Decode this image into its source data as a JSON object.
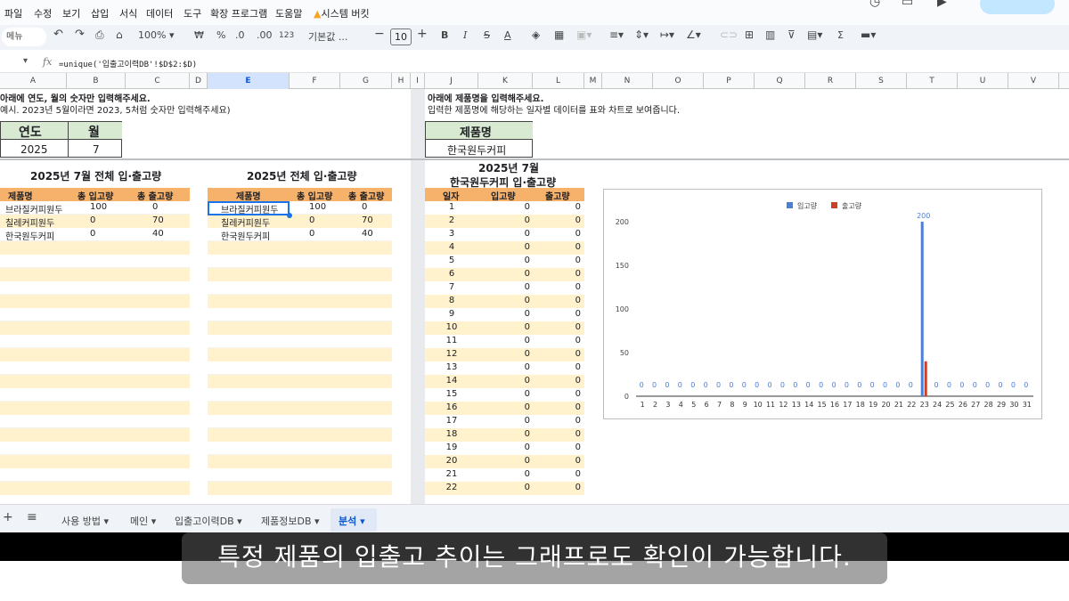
{
  "menu": [
    "파일",
    "수정",
    "보기",
    "삽입",
    "서식",
    "데이터",
    "도구",
    "확장 프로그램",
    "도움말",
    "시스템 버킷"
  ],
  "toolbar": {
    "menu_search": "메뉴",
    "zoom": "100%",
    "currency": "₩",
    "percent": "%",
    "dec_decrease": ".0",
    "dec_increase": ".00",
    "number_format": "123",
    "font": "기본값 ...",
    "font_size": "10",
    "bold": "B",
    "italic": "I",
    "strike": "S",
    "text_color": "A",
    "sigma": "Σ"
  },
  "formula_bar": {
    "cell_ref": "",
    "fx": "fx",
    "formula": "=unique('입출고이력DB'!$D$2:$D)"
  },
  "columns": [
    "A",
    "B",
    "C",
    "D",
    "E",
    "F",
    "G",
    "H",
    "I",
    "J",
    "K",
    "L",
    "M",
    "N",
    "O",
    "P",
    "Q",
    "R",
    "S",
    "T",
    "U",
    "V"
  ],
  "left": {
    "instr1": "아래에 연도, 월의 숫자만 입력해주세요.",
    "instr2": "예시. 2023년 5월이라면 2023, 5처럼 숫자만 입력해주세요)",
    "year_label": "연도",
    "month_label": "월",
    "year": "2025",
    "month": "7"
  },
  "table1": {
    "title": "2025년 7월 전체 입·출고량",
    "headers": [
      "제품명",
      "총 입고량",
      "총 출고량"
    ],
    "rows": [
      [
        "브라질커피원두",
        "100",
        "0"
      ],
      [
        "칠레커피원두",
        "0",
        "70"
      ],
      [
        "한국원두커피",
        "0",
        "40"
      ]
    ]
  },
  "table2": {
    "title": "2025년 전체 입·출고량",
    "headers": [
      "제품명",
      "총 입고량",
      "총 출고량"
    ],
    "rows": [
      [
        "브라질커피원두",
        "100",
        "0"
      ],
      [
        "칠레커피원두",
        "0",
        "70"
      ],
      [
        "한국원두커피",
        "0",
        "40"
      ]
    ]
  },
  "right": {
    "instr1": "아래에 제품명을 입력해주세요.",
    "instr2": "입력한 제품명에 해당하는 일자별 데이터를 표와 차트로 보여줍니다.",
    "product_label": "제품명",
    "product": "한국원두커피"
  },
  "table3": {
    "title1": "2025년 7월",
    "title2": "한국원두커피 입·출고량",
    "headers": [
      "일자",
      "입고량",
      "출고량"
    ],
    "rows": [
      [
        "1",
        "0",
        "0"
      ],
      [
        "2",
        "0",
        "0"
      ],
      [
        "3",
        "0",
        "0"
      ],
      [
        "4",
        "0",
        "0"
      ],
      [
        "5",
        "0",
        "0"
      ],
      [
        "6",
        "0",
        "0"
      ],
      [
        "7",
        "0",
        "0"
      ],
      [
        "8",
        "0",
        "0"
      ],
      [
        "9",
        "0",
        "0"
      ],
      [
        "10",
        "0",
        "0"
      ],
      [
        "11",
        "0",
        "0"
      ],
      [
        "12",
        "0",
        "0"
      ],
      [
        "13",
        "0",
        "0"
      ],
      [
        "14",
        "0",
        "0"
      ],
      [
        "15",
        "0",
        "0"
      ],
      [
        "16",
        "0",
        "0"
      ],
      [
        "17",
        "0",
        "0"
      ],
      [
        "18",
        "0",
        "0"
      ],
      [
        "19",
        "0",
        "0"
      ],
      [
        "20",
        "0",
        "0"
      ],
      [
        "21",
        "0",
        "0"
      ],
      [
        "22",
        "0",
        "0"
      ]
    ]
  },
  "chart_data": {
    "type": "bar",
    "categories": [
      "1",
      "2",
      "3",
      "4",
      "5",
      "6",
      "7",
      "8",
      "9",
      "10",
      "11",
      "12",
      "13",
      "14",
      "15",
      "16",
      "17",
      "18",
      "19",
      "20",
      "21",
      "22",
      "23",
      "24",
      "25",
      "26",
      "27",
      "28",
      "29",
      "30",
      "31"
    ],
    "series": [
      {
        "name": "입고량",
        "color": "#4a7fd4",
        "values": [
          0,
          0,
          0,
          0,
          0,
          0,
          0,
          0,
          0,
          0,
          0,
          0,
          0,
          0,
          0,
          0,
          0,
          0,
          0,
          0,
          0,
          0,
          200,
          0,
          0,
          0,
          0,
          0,
          0,
          0,
          0
        ]
      },
      {
        "name": "출고량",
        "color": "#cc4125",
        "values": [
          0,
          0,
          0,
          0,
          0,
          0,
          0,
          0,
          0,
          0,
          0,
          0,
          0,
          0,
          0,
          0,
          0,
          0,
          0,
          0,
          0,
          0,
          40,
          0,
          0,
          0,
          0,
          0,
          0,
          0,
          0
        ]
      }
    ],
    "data_labels": [
      "0",
      "0",
      "0",
      "0",
      "0",
      "0",
      "0",
      "0",
      "0",
      "0",
      "0",
      "0",
      "0",
      "0",
      "0",
      "0",
      "0",
      "0",
      "0",
      "0",
      "0",
      "0",
      "200",
      "0",
      "0",
      "0",
      "0",
      "0",
      "0",
      "0",
      "0"
    ],
    "yticks": [
      "0",
      "50",
      "100",
      "150",
      "200"
    ],
    "ylim": [
      0,
      200
    ],
    "legend": "top",
    "grid": false
  },
  "tabs": [
    {
      "label": "사용 방법"
    },
    {
      "label": "메인"
    },
    {
      "label": "입출고이력DB"
    },
    {
      "label": "제품정보DB"
    },
    {
      "label": "분석"
    }
  ],
  "tab_add": "+",
  "tab_list": "≡",
  "subtitle": "특정 제품의 입출고 추이는 그래프로도 확인이 가능합니다."
}
